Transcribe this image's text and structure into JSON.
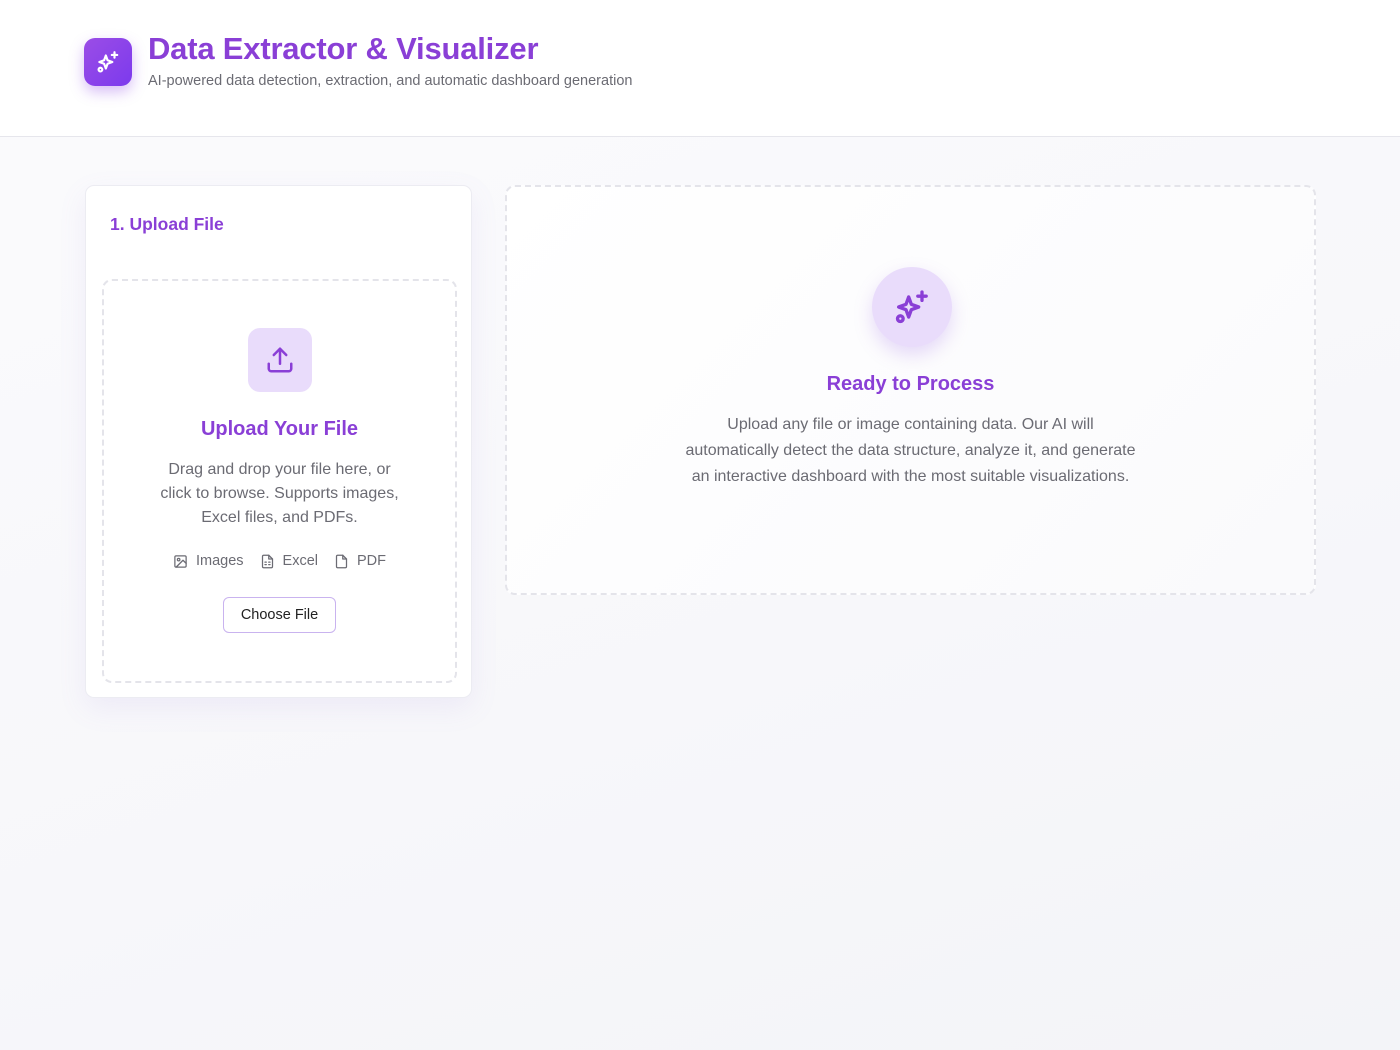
{
  "header": {
    "logo_icon": "sparkles-icon",
    "title": "Data Extractor & Visualizer",
    "subtitle": "AI-powered data detection, extraction, and automatic dashboard generation"
  },
  "upload_panel": {
    "title": "1. Upload File",
    "dropzone": {
      "icon": "upload-icon",
      "title": "Upload Your File",
      "description": "Drag and drop your file here, or click to browse. Supports images, Excel files, and PDFs.",
      "file_types": [
        {
          "label": "Images",
          "icon": "image-icon"
        },
        {
          "label": "Excel",
          "icon": "spreadsheet-file-icon"
        },
        {
          "label": "PDF",
          "icon": "file-icon"
        }
      ],
      "button_label": "Choose File"
    }
  },
  "result_panel": {
    "icon": "sparkles-icon",
    "title": "Ready to Process",
    "description": "Upload any file or image containing data. Our AI will automatically detect the data structure, analyze it, and generate an interactive dashboard with the most suitable visualizations."
  },
  "colors": {
    "accent": "#8a3fd6",
    "accent_light": "#e9dcfb",
    "text_muted": "#6b6b73"
  }
}
